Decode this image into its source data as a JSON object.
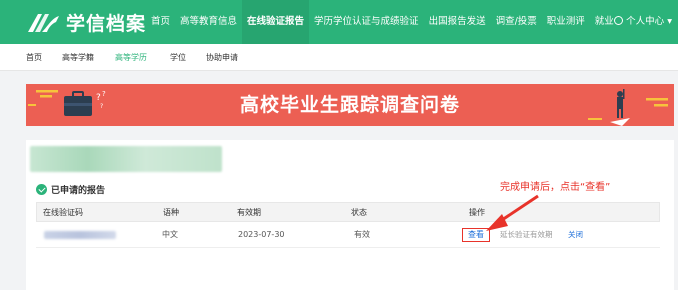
{
  "header": {
    "logo_text": "学信档案",
    "nav": [
      {
        "label": "首页"
      },
      {
        "label": "高等教育信息"
      },
      {
        "label": "在线验证报告"
      },
      {
        "label": "学历学位认证与成绩验证"
      },
      {
        "label": "出国报告发送"
      },
      {
        "label": "调查/投票"
      },
      {
        "label": "职业测评"
      },
      {
        "label": "就业"
      }
    ],
    "user_center": "个人中心",
    "user_center_arrow": "▾",
    "brand_color": "#2bb37a"
  },
  "subnav": [
    {
      "label": "首页"
    },
    {
      "label": "高等学籍"
    },
    {
      "label": "高等学历"
    },
    {
      "label": "学位"
    },
    {
      "label": "协助申请"
    }
  ],
  "banner": {
    "title": "高校毕业生跟踪调查问卷",
    "color": "#ec5f53"
  },
  "section": {
    "applied_label": "已申请的报告"
  },
  "annotation": {
    "text": "完成申请后，点击“查看”",
    "color": "#e8332a"
  },
  "table": {
    "headers": [
      "在线验证码",
      "语种",
      "有效期",
      "状态",
      "操作"
    ],
    "rows": [
      {
        "language": "中文",
        "expiry": "2023-07-30",
        "status": "有效",
        "view": "查看",
        "extend": "延长验证有效期",
        "close": "关闭"
      }
    ]
  }
}
